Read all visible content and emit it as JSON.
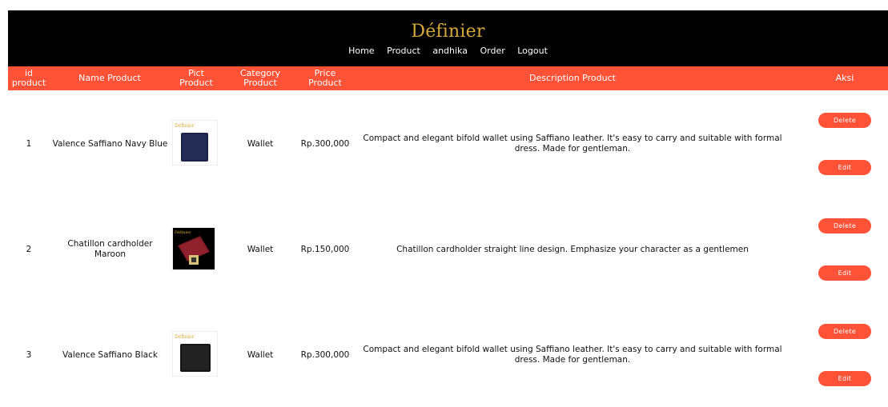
{
  "brand": "Définier",
  "nav": [
    "Home",
    "Product",
    "andhika",
    "Order",
    "Logout"
  ],
  "headers": {
    "id": "id product",
    "name": "Name Product",
    "pict": "Pict Product",
    "category": "Category Product",
    "price": "Price Product",
    "description": "Description Product",
    "action": "Aksi"
  },
  "thumb_brand_text": "Définier",
  "rows": [
    {
      "id": "1",
      "name": "Valence Saffiano Navy Blue",
      "category": "Wallet",
      "price": "Rp.300,000",
      "description": "Compact and elegant bifold wallet using Saffiano leather. It's easy to carry and suitable with formal dress. Made for gentleman.",
      "delete_label": "Delete",
      "edit_label": "Edit"
    },
    {
      "id": "2",
      "name": "Chatillon cardholder Maroon",
      "category": "Wallet",
      "price": "Rp.150,000",
      "description": "Chatillon cardholder straight line design. Emphasize your character as a gentlemen",
      "delete_label": "Delete",
      "edit_label": "Edit"
    },
    {
      "id": "3",
      "name": "Valence Saffiano Black",
      "category": "Wallet",
      "price": "Rp.300,000",
      "description": "Compact and elegant bifold wallet using Saffiano leather. It's easy to carry and suitable with formal dress. Made for gentleman.",
      "delete_label": "Delete",
      "edit_label": "Edit"
    }
  ],
  "colors": {
    "accent": "#ff5236",
    "header_bg": "#000000",
    "brand_gold": "#d8a93a"
  }
}
